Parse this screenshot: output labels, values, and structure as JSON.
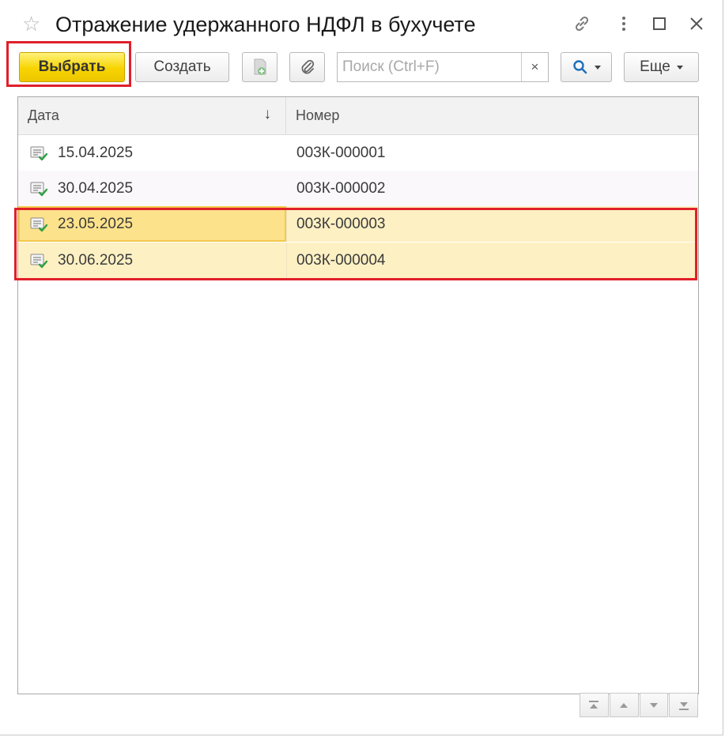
{
  "window": {
    "title": "Отражение удержанного НДФЛ в бухучете",
    "icons": [
      "star-icon",
      "link-icon",
      "menu-icon",
      "maximize-icon",
      "close-icon"
    ]
  },
  "toolbar": {
    "select_label": "Выбрать",
    "create_label": "Создать",
    "search_placeholder": "Поиск (Ctrl+F)",
    "search_value": "",
    "clear_label": "×",
    "more_label": "Еще",
    "accent_color": "#f7d400",
    "highlight_color": "#e0202a"
  },
  "table": {
    "columns": {
      "date": "Дата",
      "number": "Номер"
    },
    "sort_indicator": "↓",
    "rows": [
      {
        "date": "15.04.2025",
        "number": "003К-000001",
        "selected": false
      },
      {
        "date": "30.04.2025",
        "number": "003К-000002",
        "selected": false
      },
      {
        "date": "23.05.2025",
        "number": "003К-000003",
        "selected": true
      },
      {
        "date": "30.06.2025",
        "number": "003К-000004",
        "selected": true
      }
    ]
  },
  "navigation": [
    "go-first-icon",
    "go-prev-icon",
    "go-next-icon",
    "go-last-icon"
  ]
}
